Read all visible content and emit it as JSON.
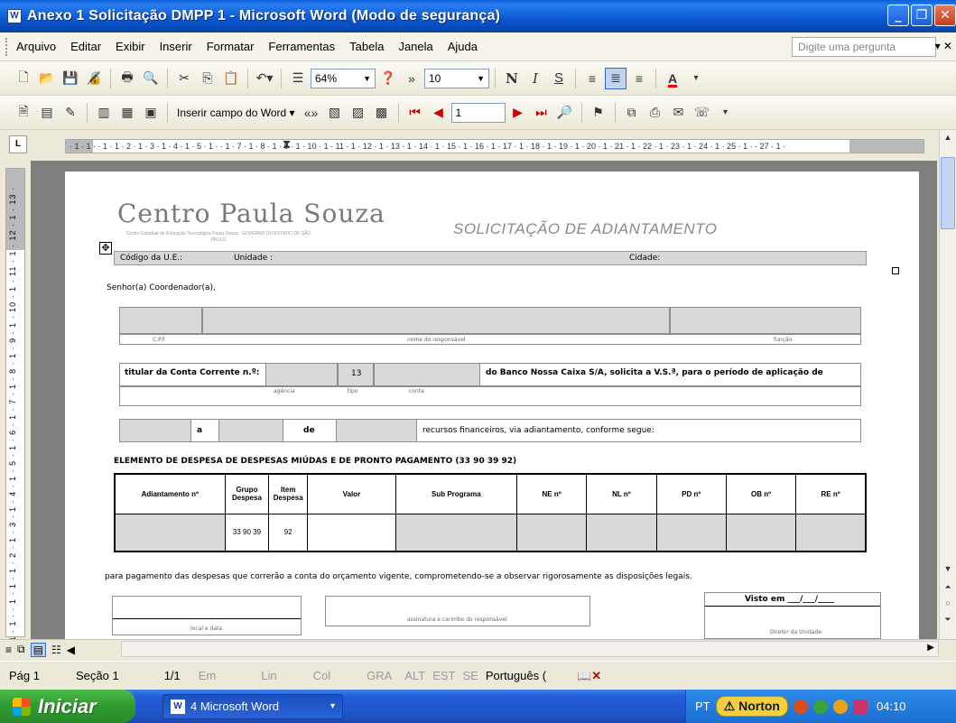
{
  "window": {
    "title": "Anexo 1 Solicitação DMPP 1 - Microsoft Word (Modo de segurança)"
  },
  "menu": {
    "items": [
      "Arquivo",
      "Editar",
      "Exibir",
      "Inserir",
      "Formatar",
      "Ferramentas",
      "Tabela",
      "Janela",
      "Ajuda"
    ],
    "ask_placeholder": "Digite uma pergunta"
  },
  "toolbar1": {
    "zoom": "64%",
    "font_size": "10",
    "bold": "N",
    "italic": "I",
    "underline": "S",
    "font_color_letter": "A"
  },
  "toolbar2": {
    "insert_field": "Inserir campo do Word",
    "record_number": "1"
  },
  "ruler": {
    "corner": "L",
    "hticks": "· 1 · 1 ·  · 1 · 1 · 2 · 1 · 3 · 1 · 4 · 1 · 5 · 1 ·  · 1 · 7 · 1 · 8 · 1 · 9 · 1 · 10 · 1 · 11 · 1 · 12 · 1 · 13 · 1 · 14 · 1 · 15 · 1 · 16 · 1 · 17 · 1 · 18 · 1 · 19 · 1 · 20 · 1 · 21 · 1 · 22 · 1 · 23 · 1 · 24 · 1 · 25 · 1 ·  · 27 · 1 ·",
    "vticks": "2 · 1 · 1 · 1 ·  · 1 · 1 · 1 · 2 · 1 · 3 · 1 · 4 · 1 · 5 · 1 · 6 · 1 · 7 · 1 · 8 · 1 · 9 · 1 · 10 · 1 · 11 · 1 · 12 · 1 · 13 ·"
  },
  "document": {
    "logo": "Centro Paula Souza",
    "logo_sub": "Centro Estadual de Educação Tecnológica Paula Souza · GOVERNO DO ESTADO DE SÃO PAULO",
    "title": "SOLICITAÇÃO DE ADIANTAMENTO",
    "header_row": {
      "codigo": "Código da U.E.:",
      "unidade": "Unidade :",
      "cidade": "Cidade:"
    },
    "salutation": "Senhor(a) Coordenador(a),",
    "row_labels": {
      "cpf": "C.P.F.",
      "nome": "nome do responsável",
      "funcao": "função"
    },
    "account_line": {
      "titular": "titular da Conta Corrente n.º:",
      "code": "13",
      "banco": "do Banco Nossa Caixa S/A, solicita a V.S.ª, para o período de aplicação de",
      "agencia": "agência",
      "tipo": "tipo",
      "conta": "conta"
    },
    "period_line": {
      "a": "a",
      "de": "de",
      "recursos": "recursos financeiros, via adiantamento, conforme segue:"
    },
    "elemento": "ELEMENTO DE DESPESA DE DESPESAS MIÚDAS E DE PRONTO PAGAMENTO (33 90 39 92)",
    "table": {
      "headers": [
        "Adiantamento nº",
        "Grupo Despesa",
        "Item Despesa",
        "Valor",
        "Sub Programa",
        "NE nº",
        "NL nº",
        "PD nº",
        "OB nº",
        "RE nº"
      ],
      "values": [
        "",
        "33 90 39",
        "92",
        "",
        "",
        "",
        "",
        "",
        "",
        ""
      ]
    },
    "footer_text": "para pagamento das despesas que correrão a conta do orçamento vigente, comprometendo-se a observar rigorosamente as disposições legais.",
    "sign": {
      "local_data": "local e data",
      "carimbo": "assinatura e carimbo do responsável",
      "visto": "Visto em ___/___/____",
      "diretor": "Diretor da Unidade"
    }
  },
  "status": {
    "page": "Pág 1",
    "section": "Seção 1",
    "pages": "1/1",
    "em": "Em",
    "lin": "Lin",
    "col": "Col",
    "gra": "GRA",
    "alt": "ALT",
    "est": "EST",
    "se": "SE",
    "language": "Português ("
  },
  "taskbar": {
    "start": "Iniciar",
    "task": "4 Microsoft Word",
    "lang": "PT",
    "norton": "Norton",
    "clock": "04:10"
  }
}
